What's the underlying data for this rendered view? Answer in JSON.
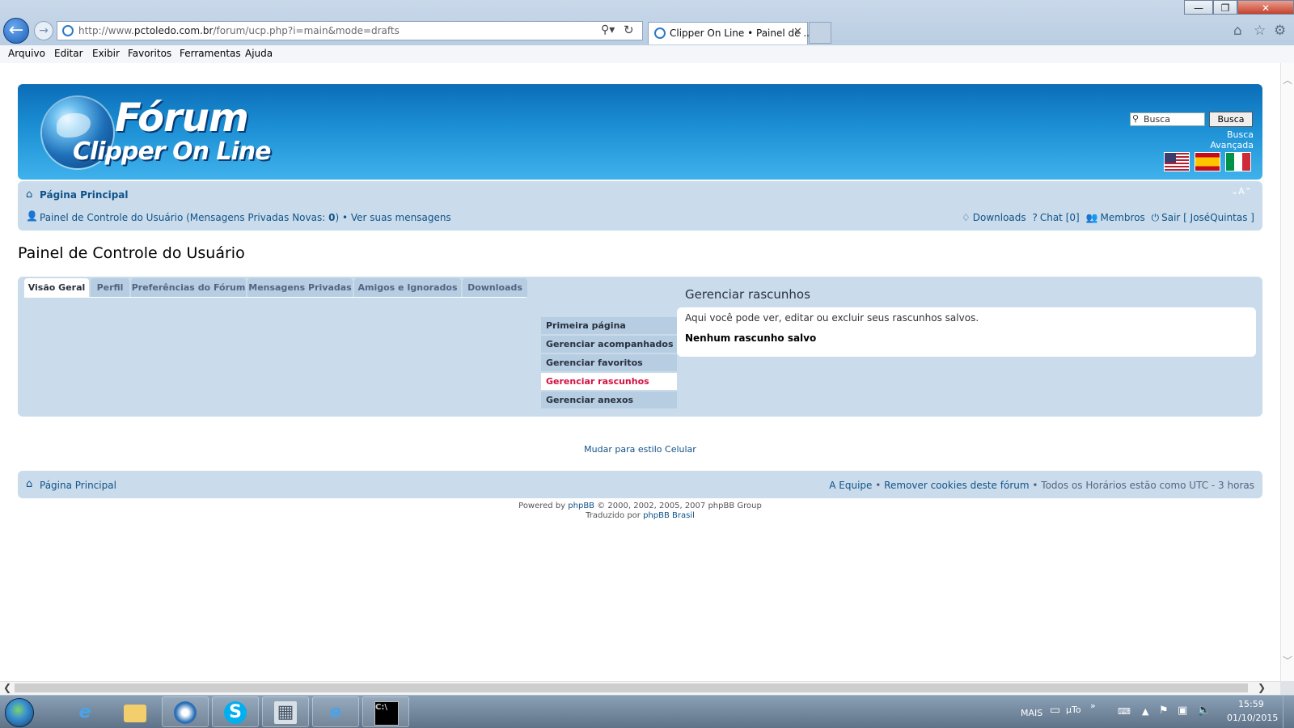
{
  "browser": {
    "url_prefix": "http://www.",
    "url_domain": "pctoledo.com.br",
    "url_path": "/forum/ucp.php?i=main&mode=drafts",
    "tab_title": "Clipper On Line • Painel de ...",
    "tab_close": "✕",
    "window_controls": [
      "—",
      "❐",
      "✕"
    ],
    "menu": [
      "Arquivo",
      "Editar",
      "Exibir",
      "Favoritos",
      "Ferramentas",
      "Ajuda"
    ]
  },
  "header": {
    "logo_line1": "Fórum",
    "logo_line2": "Clipper On Line",
    "search_placeholder": "Busca",
    "search_button": "Busca",
    "advanced_search": "Busca Avançada",
    "flags": [
      "us-flag",
      "es-flag",
      "it-flag"
    ]
  },
  "nav": {
    "home": "Página Principal",
    "font_ctl": "⌄A⌃",
    "ucp_link": "Painel de Controle do Usuário",
    "pm_text_pre": " (Mensagens Privadas Novas: ",
    "pm_count": "0",
    "pm_text_post": ")",
    "sep": " • ",
    "view_messages": "Ver suas mensagens",
    "downloads": "Downloads",
    "chat": "Chat [0]",
    "members": "Membros",
    "logout": "Sair [ JoséQuintas ]"
  },
  "main": {
    "page_title": "Painel de Controle do Usuário",
    "tabs": [
      "Visão Geral",
      "Perfil",
      "Preferências do Fórum",
      "Mensagens Privadas",
      "Amigos e Ignorados",
      "Downloads"
    ],
    "submenu": [
      "Primeira página",
      "Gerenciar acompanhados",
      "Gerenciar favoritos",
      "Gerenciar rascunhos",
      "Gerenciar anexos"
    ],
    "active_submenu_index": 3,
    "content_title": "Gerenciar rascunhos",
    "content_desc": "Aqui você pode ver, editar ou excluir seus rascunhos salvos.",
    "content_empty": "Nenhum rascunho salvo",
    "mobile_link": "Mudar para estilo Celular"
  },
  "footer": {
    "home": "Página Principal",
    "team": "A Equipe",
    "sep": " • ",
    "cookies": "Remover cookies deste fórum",
    "timezone": "Todos os Horários estão como UTC - 3 horas",
    "powered_pre": "Powered by ",
    "powered_link": "phpBB",
    "powered_post": " © 2000, 2002, 2005, 2007 phpBB Group",
    "translated_pre": "Traduzido por ",
    "translated_link": "phpBB Brasil"
  },
  "taskbar": {
    "tray_mais": "MAIS",
    "tray_utorrent": "µTo",
    "tray_more": "»",
    "time": "15:59",
    "date": "01/10/2015"
  },
  "colors": {
    "link": "#105289",
    "panel": "#cadceb",
    "active_sub": "#d31141",
    "header_dark": "#0b6db7",
    "header_light": "#3fb2ec"
  }
}
